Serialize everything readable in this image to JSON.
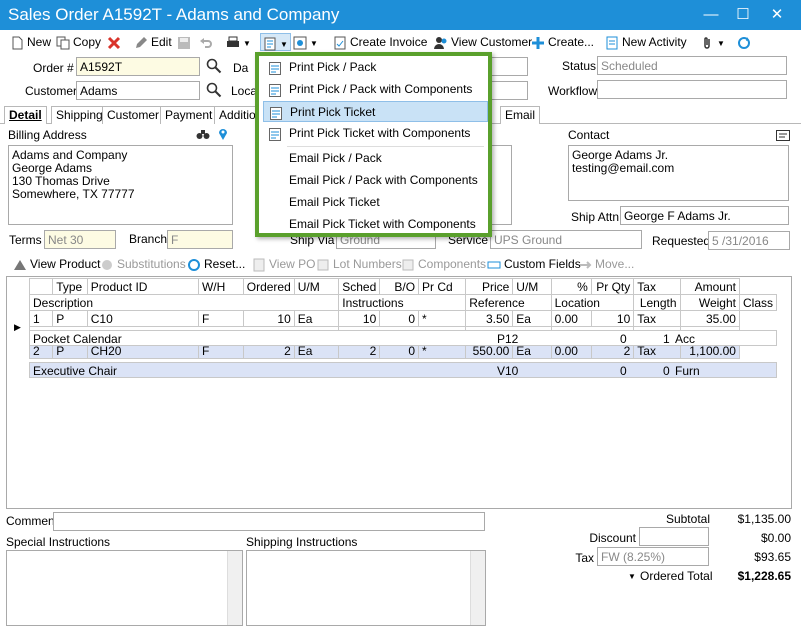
{
  "window": {
    "title": "Sales Order A1592T - Adams and Company",
    "minimize": "—",
    "maximize": "☐",
    "close": "✕"
  },
  "toolbar": {
    "new": "New",
    "copy": "Copy",
    "edit": "Edit",
    "create_invoice": "Create Invoice",
    "view_customer": "View Customer",
    "create": "Create...",
    "new_activity": "New Activity"
  },
  "header": {
    "order_label": "Order #",
    "order_value": "A1592T",
    "customer_label": "Customer",
    "customer_value": "Adams",
    "date_label": "Da",
    "location_label": "Locat",
    "status_label": "Status",
    "status_value": "Scheduled",
    "workflow_label": "Workflow",
    "workflow_value": ""
  },
  "tabs": [
    "Detail",
    "Shipping",
    "Customer",
    "Payment",
    "Addition",
    "Email"
  ],
  "billing": {
    "label": "Billing Address",
    "lines": [
      "Adams and Company",
      "George Adams",
      "130 Thomas Drive",
      "Somewhere, TX 77777"
    ]
  },
  "contact": {
    "label": "Contact",
    "lines": [
      "George Adams Jr.",
      "testing@email.com"
    ],
    "ship_attn_label": "Ship Attn",
    "ship_attn_value": "George F Adams Jr."
  },
  "terms": {
    "terms_label": "Terms",
    "terms_value": "Net 30",
    "branch_label": "Branch",
    "branch_value": "F",
    "ship_via_label": "Ship Via",
    "ship_via_value": "Ground",
    "service_label": "Service",
    "service_value": "UPS  Ground",
    "requested_label": "Requested",
    "requested_value": "5 /31/2016"
  },
  "line_toolbar": {
    "view_product": "View Product",
    "substitutions": "Substitutions",
    "reset": "Reset...",
    "view_po": "View PO",
    "lot_numbers": "Lot Numbers",
    "components": "Components",
    "custom_fields": "Custom Fields",
    "move": "Move..."
  },
  "grid": {
    "header1": [
      "Type",
      "Product ID",
      "W/H",
      "Ordered",
      "U/M",
      "Sched",
      "B/O",
      "Pr Cd",
      "Price",
      "U/M",
      "%",
      "Pr Qty",
      "Tax",
      "Amount"
    ],
    "header2": [
      "Description",
      "Instructions",
      "Reference",
      "Location",
      "Length",
      "Weight",
      "Class"
    ],
    "rows": [
      {
        "line": "1",
        "type": "P",
        "product": "C10",
        "wh": "F",
        "ordered": "10",
        "um": "Ea",
        "sched": "10",
        "bo": "0",
        "prcd": "*",
        "price": "3.50",
        "um2": "Ea",
        "pct": "0.00",
        "prqty": "10",
        "tax": "Tax",
        "amount": "35.00",
        "desc": "Pocket Calendar",
        "location": "P12",
        "length": "0",
        "weight": "1",
        "class": "Acc"
      },
      {
        "line": "2",
        "type": "P",
        "product": "CH20",
        "wh": "F",
        "ordered": "2",
        "um": "Ea",
        "sched": "2",
        "bo": "0",
        "prcd": "*",
        "price": "550.00",
        "um2": "Ea",
        "pct": "0.00",
        "prqty": "2",
        "tax": "Tax",
        "amount": "1,100.00",
        "desc": "Executive Chair",
        "location": "V10",
        "length": "0",
        "weight": "0",
        "class": "Furn"
      }
    ]
  },
  "footer": {
    "comment_label": "Comment",
    "special_label": "Special Instructions",
    "shipping_label": "Shipping Instructions",
    "subtotal_label": "Subtotal",
    "subtotal_value": "$1,135.00",
    "discount_label": "Discount",
    "discount_value": "$0.00",
    "tax_label": "Tax",
    "tax_field": "FW (8.25%)",
    "tax_value": "$93.65",
    "ordered_total_label": "Ordered Total",
    "ordered_total_value": "$1,228.65"
  },
  "menu": {
    "items": [
      "Print Pick / Pack",
      "Print Pick / Pack with Components",
      "Print Pick Ticket",
      "Print Pick Ticket with Components",
      "Email Pick / Pack",
      "Email Pick / Pack with Components",
      "Email Pick Ticket",
      "Email Pick Ticket with Components"
    ]
  },
  "colors": {
    "titlebar": "#1e8fd8",
    "menu_border": "#5aa02c",
    "highlight": "#c9e2f6",
    "selected_row": "#dbe3f6",
    "field_yellow": "#fdfbe3"
  }
}
